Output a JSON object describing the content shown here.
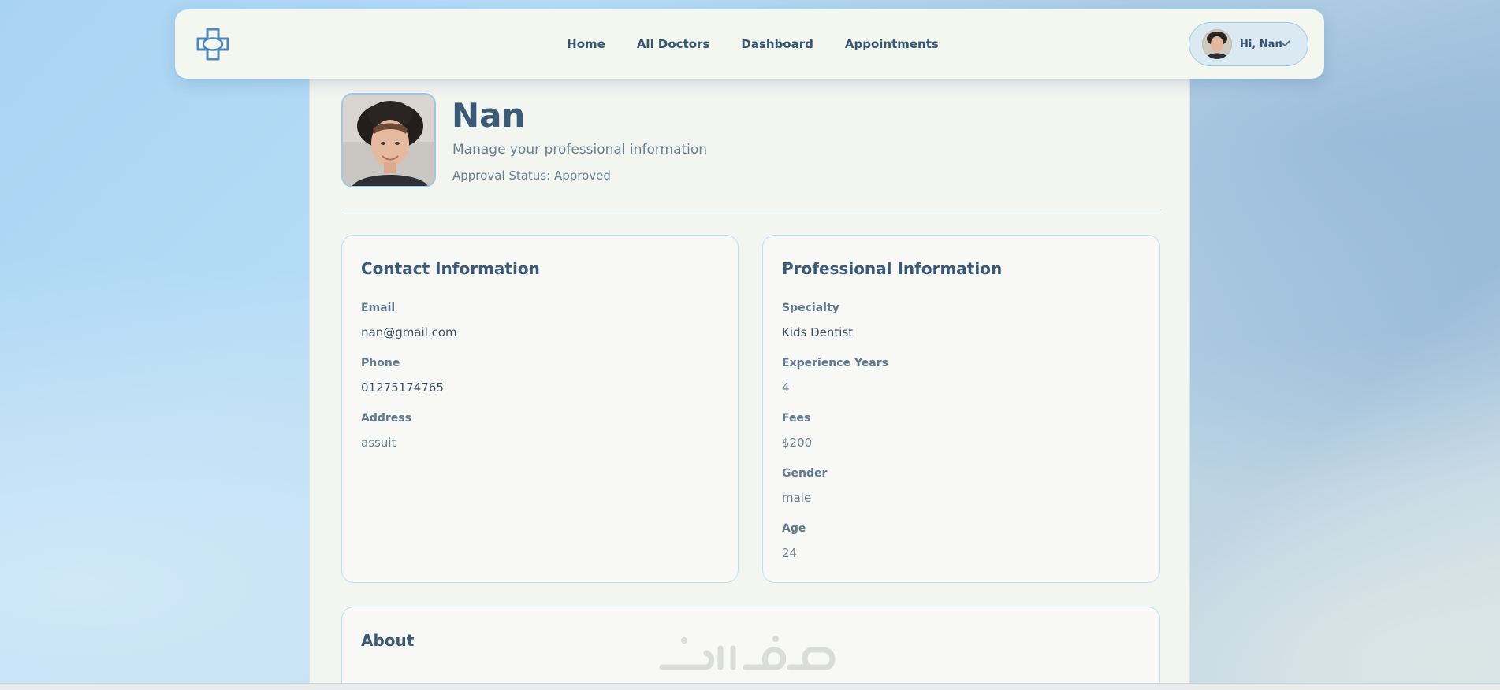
{
  "colors": {
    "accent": "#3a5a78",
    "logo": "#4f86b8",
    "pill_border": "#9ec9e4",
    "card_border": "#bfe0f0"
  },
  "navbar": {
    "logo_icon": "medical-cross-icon",
    "links": [
      "Home",
      "All Doctors",
      "Dashboard",
      "Appointments"
    ],
    "user": {
      "greeting": "Hi, Nan",
      "avatar_icon": "user-avatar",
      "dropdown_icon": "chevron-down-icon"
    }
  },
  "profile": {
    "name": "Nan",
    "subtitle": "Manage your professional information",
    "status": "Approval Status: Approved"
  },
  "contact": {
    "title": "Contact Information",
    "fields": [
      {
        "label": "Email",
        "value": "nan@gmail.com"
      },
      {
        "label": "Phone",
        "value": "01275174765"
      },
      {
        "label": "Address",
        "value": "assuit"
      }
    ]
  },
  "professional": {
    "title": "Professional Information",
    "fields": [
      {
        "label": "Specialty",
        "value": "Kids Dentist"
      },
      {
        "label": "Experience Years",
        "value": "4"
      },
      {
        "label": "Fees",
        "value": "$200"
      },
      {
        "label": "Gender",
        "value": "male"
      },
      {
        "label": "Age",
        "value": "24"
      }
    ]
  },
  "about": {
    "title": "About"
  }
}
